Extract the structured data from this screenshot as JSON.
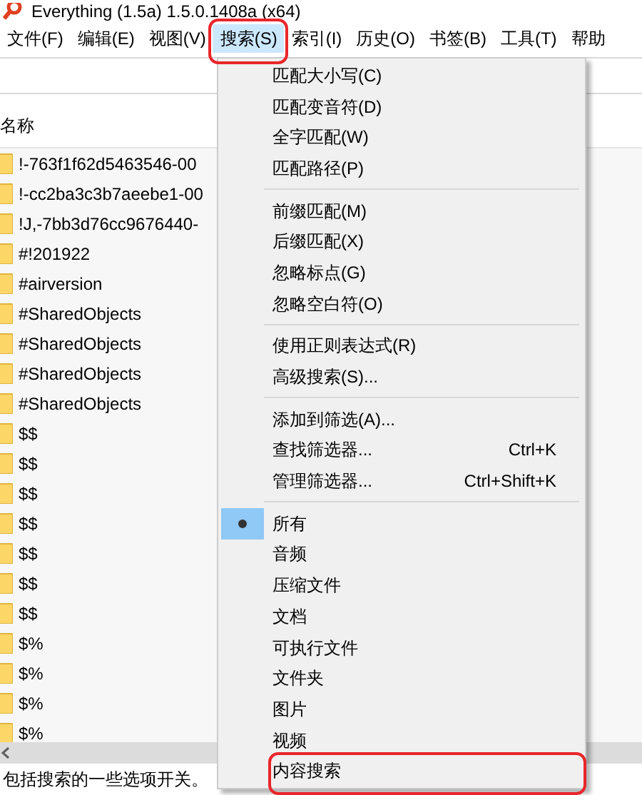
{
  "window": {
    "title": "Everything (1.5a) 1.5.0.1408a (x64)"
  },
  "menubar": [
    {
      "label": "文件(F)",
      "selected": false,
      "annotated": false
    },
    {
      "label": "编辑(E)",
      "selected": false,
      "annotated": false
    },
    {
      "label": "视图(V)",
      "selected": false,
      "annotated": false
    },
    {
      "label": "搜索(S)",
      "selected": true,
      "annotated": true
    },
    {
      "label": "索引(I)",
      "selected": false,
      "annotated": false
    },
    {
      "label": "历史(O)",
      "selected": false,
      "annotated": false
    },
    {
      "label": "书签(B)",
      "selected": false,
      "annotated": false
    },
    {
      "label": "工具(T)",
      "selected": false,
      "annotated": false
    },
    {
      "label": "帮助",
      "selected": false,
      "annotated": false
    }
  ],
  "table": {
    "columns": [
      "名称"
    ],
    "rows": [
      "!-763f1f62d5463546-00",
      "!-cc2ba3c3b7aeebe1-00",
      "!J,-7bb3d76cc9676440-",
      "#!201922",
      "#airversion",
      "#SharedObjects",
      "#SharedObjects",
      "#SharedObjects",
      "#SharedObjects",
      "$$",
      "$$",
      "$$",
      "$$",
      "$$",
      "$$",
      "$$",
      "$%",
      "$%",
      "$%",
      "$%"
    ]
  },
  "status_bar": "包括搜索的一些选项开关。",
  "search_menu": [
    {
      "kind": "item",
      "label": "匹配大小写(C)"
    },
    {
      "kind": "item",
      "label": "匹配变音符(D)"
    },
    {
      "kind": "item",
      "label": "全字匹配(W)"
    },
    {
      "kind": "item",
      "label": "匹配路径(P)"
    },
    {
      "kind": "separator"
    },
    {
      "kind": "item",
      "label": "前缀匹配(M)"
    },
    {
      "kind": "item",
      "label": "后缀匹配(X)"
    },
    {
      "kind": "item",
      "label": "忽略标点(G)"
    },
    {
      "kind": "item",
      "label": "忽略空白符(O)"
    },
    {
      "kind": "separator"
    },
    {
      "kind": "item",
      "label": "使用正则表达式(R)"
    },
    {
      "kind": "item",
      "label": "高级搜索(S)..."
    },
    {
      "kind": "separator"
    },
    {
      "kind": "item",
      "label": "添加到筛选(A)..."
    },
    {
      "kind": "item",
      "label": "查找筛选器...",
      "shortcut": "Ctrl+K"
    },
    {
      "kind": "item",
      "label": "管理筛选器...",
      "shortcut": "Ctrl+Shift+K"
    },
    {
      "kind": "separator"
    },
    {
      "kind": "radio",
      "label": "所有",
      "selected": true
    },
    {
      "kind": "radio",
      "label": "音频",
      "selected": false
    },
    {
      "kind": "radio",
      "label": "压缩文件",
      "selected": false
    },
    {
      "kind": "radio",
      "label": "文档",
      "selected": false
    },
    {
      "kind": "radio",
      "label": "可执行文件",
      "selected": false
    },
    {
      "kind": "radio",
      "label": "文件夹",
      "selected": false
    },
    {
      "kind": "radio",
      "label": "图片",
      "selected": false
    },
    {
      "kind": "radio",
      "label": "视频",
      "selected": false
    },
    {
      "kind": "radio",
      "label": "内容搜索",
      "selected": false,
      "annotated": true
    }
  ]
}
